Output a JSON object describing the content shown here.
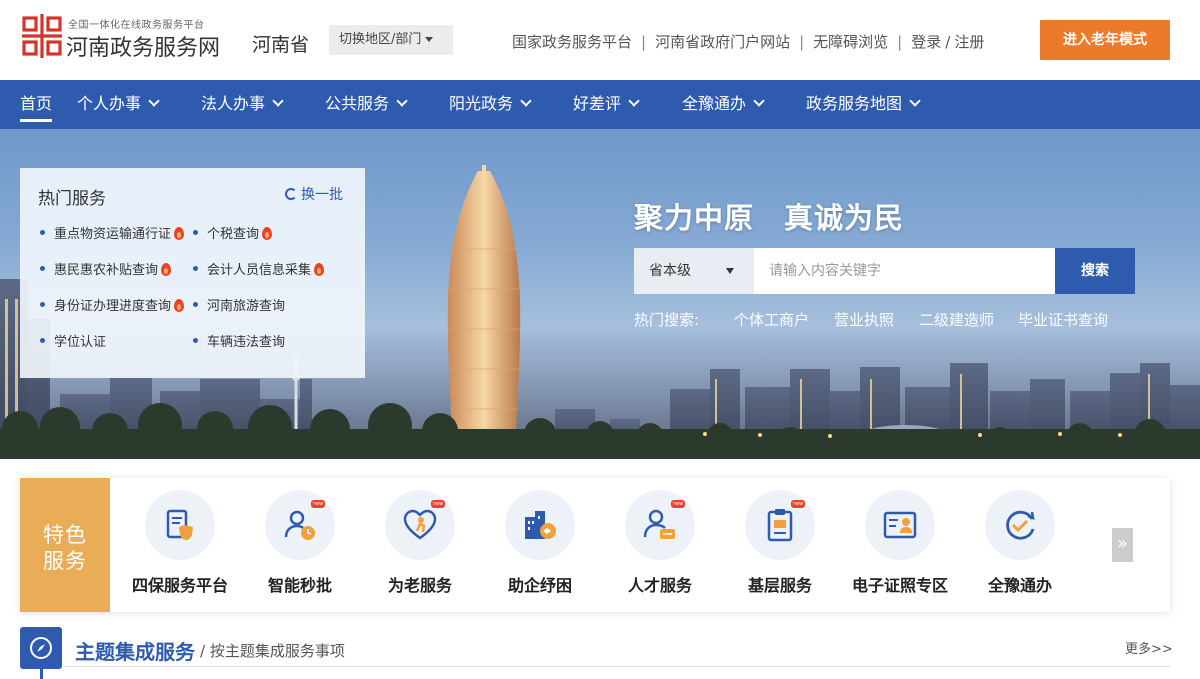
{
  "header": {
    "logo_subtitle": "全国一体化在线政务服务平台",
    "logo_title": "河南政务服务网",
    "province": "河南省",
    "switch_label": "切换地区/部门",
    "links": [
      "国家政务服务平台",
      "河南省政府门户网站",
      "无障碍浏览"
    ],
    "login": "登录",
    "register": "注册",
    "elder_mode": "进入老年模式"
  },
  "nav": {
    "items": [
      {
        "label": "首页"
      },
      {
        "label": "个人办事"
      },
      {
        "label": "法人办事"
      },
      {
        "label": "公共服务"
      },
      {
        "label": "阳光政务"
      },
      {
        "label": "好差评"
      },
      {
        "label": "全豫通办"
      },
      {
        "label": "政务服务地图"
      }
    ]
  },
  "hot_services": {
    "title": "热门服务",
    "refresh": "换一批",
    "items": [
      {
        "label": "重点物资运输通行证",
        "hot": true
      },
      {
        "label": "个税查询",
        "hot": true
      },
      {
        "label": "惠民惠农补贴查询",
        "hot": true
      },
      {
        "label": "会计人员信息采集",
        "hot": true
      },
      {
        "label": "身份证办理进度查询",
        "hot": true
      },
      {
        "label": "河南旅游查询",
        "hot": false
      },
      {
        "label": "学位认证",
        "hot": false
      },
      {
        "label": "车辆违法查询",
        "hot": false
      }
    ]
  },
  "banner": {
    "slogan": "聚力中原　真诚为民",
    "search": {
      "level": "省本级",
      "placeholder": "请输入内容关键字",
      "button": "搜索"
    },
    "hot_search_label": "热门搜索:",
    "hot_search": [
      "个体工商户",
      "营业执照",
      "二级建造师",
      "毕业证书查询"
    ]
  },
  "features": {
    "label_line1": "特色",
    "label_line2": "服务",
    "new_badge": "new",
    "items": [
      {
        "label": "四保服务平台",
        "icon": "document-shield-icon",
        "new": false
      },
      {
        "label": "智能秒批",
        "icon": "user-clock-icon",
        "new": true
      },
      {
        "label": "为老服务",
        "icon": "heart-elder-icon",
        "new": true
      },
      {
        "label": "助企纾困",
        "icon": "building-handshake-icon",
        "new": false
      },
      {
        "label": "人才服务",
        "icon": "person-card-icon",
        "new": true
      },
      {
        "label": "基层服务",
        "icon": "clipboard-icon",
        "new": true
      },
      {
        "label": "电子证照专区",
        "icon": "id-card-icon",
        "new": false
      },
      {
        "label": "全豫通办",
        "icon": "check-circle-icon",
        "new": false
      }
    ],
    "more": "»"
  },
  "theme": {
    "title": "主题集成服务",
    "subtitle": "/ 按主题集成服务事项",
    "more": "更多>>"
  },
  "colors": {
    "nav_blue": "#2e5bad",
    "elder_orange": "#ec7a2b",
    "feature_gold": "#e9ad58",
    "hot_red": "#e8412c"
  }
}
